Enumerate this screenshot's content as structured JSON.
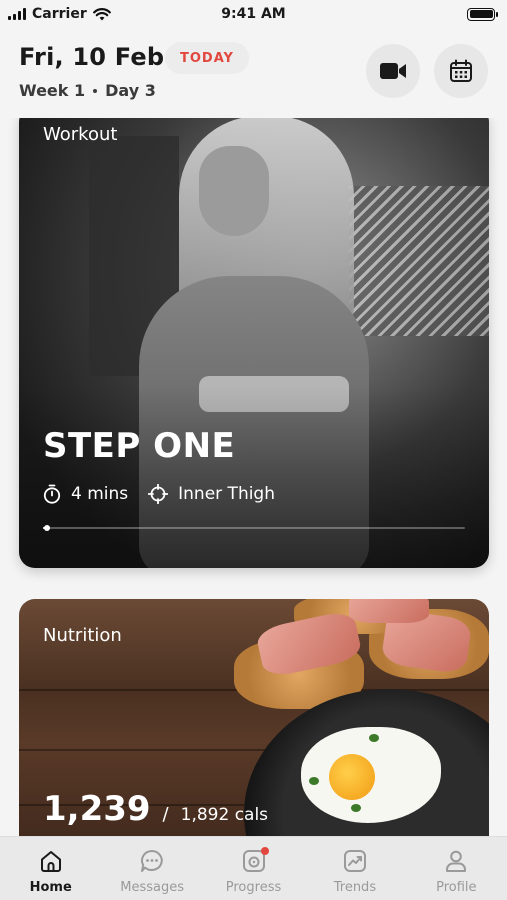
{
  "status_bar": {
    "carrier": "Carrier",
    "time": "9:41 AM",
    "battery_level": 1.0,
    "signal_bars": 4
  },
  "header": {
    "date": "Fri, 10 Feb",
    "today_badge": "TODAY",
    "week": "Week 1",
    "day": "Day 3",
    "video_icon": "video-camera-icon",
    "calendar_icon": "calendar-icon"
  },
  "workout_card": {
    "label": "Workout",
    "title": "STEP ONE",
    "duration": "4 mins",
    "target": "Inner Thigh",
    "progress": 0.01,
    "duration_icon": "stopwatch-icon",
    "target_icon": "crosshair-icon"
  },
  "nutrition_card": {
    "label": "Nutrition",
    "calories": "1,239",
    "separator": "/",
    "calorie_target": "1,892 cals"
  },
  "tabs": [
    {
      "label": "Home",
      "icon": "home-icon",
      "active": true
    },
    {
      "label": "Messages",
      "icon": "chat-bubble-icon",
      "active": false
    },
    {
      "label": "Progress",
      "icon": "progress-camera-icon",
      "active": false,
      "notification": true
    },
    {
      "label": "Trends",
      "icon": "trend-chart-icon",
      "active": false
    },
    {
      "label": "Profile",
      "icon": "person-icon",
      "active": false
    }
  ],
  "colors": {
    "accent": "#e2473f",
    "active_tab": "#1a1a1a",
    "inactive_tab": "#9a9a9a"
  }
}
